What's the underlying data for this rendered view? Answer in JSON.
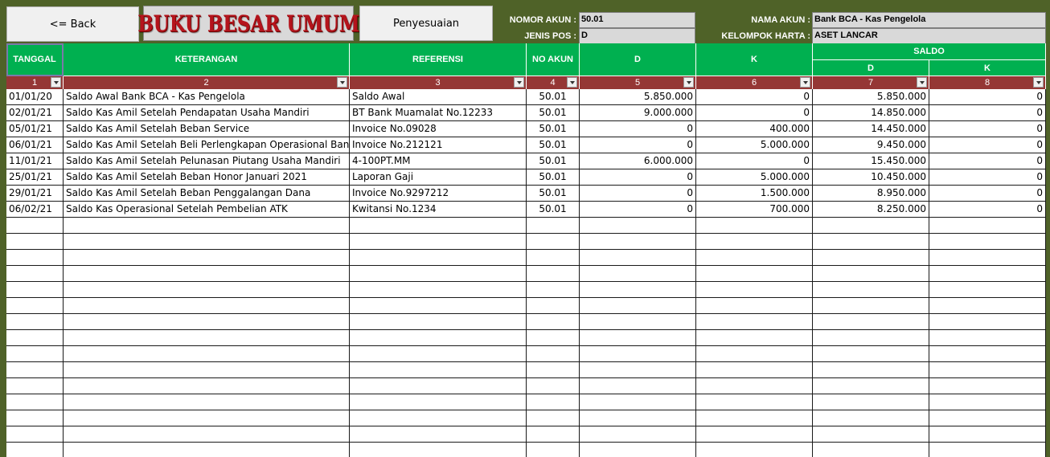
{
  "toolbar": {
    "back_label": "<= Back",
    "title": "BUKU BESAR UMUM",
    "adjust_label": "Penyesuaian"
  },
  "account": {
    "nomor_label": "NOMOR AKUN :",
    "nomor_value": "50.01",
    "jenis_label": "JENIS POS :",
    "jenis_value": "D",
    "nama_label": "NAMA AKUN :",
    "nama_value": "Bank BCA - Kas Pengelola",
    "kelompok_label": "KELOMPOK HARTA :",
    "kelompok_value": "ASET LANCAR"
  },
  "table": {
    "headers": {
      "tanggal": "TANGGAL",
      "keterangan": "KETERANGAN",
      "referensi": "REFERENSI",
      "no_akun": "NO AKUN",
      "debit": "D",
      "kredit": "K",
      "saldo": "SALDO",
      "saldo_debit": "D",
      "saldo_kredit": "K"
    },
    "col_numbers": [
      "1",
      "2",
      "3",
      "4",
      "5",
      "6",
      "7",
      "8"
    ],
    "rows": [
      [
        "01/01/20",
        "Saldo Awal Bank BCA - Kas Pengelola",
        "Saldo Awal",
        "50.01",
        "5.850.000",
        "0",
        "5.850.000",
        "0"
      ],
      [
        "02/01/21",
        "Saldo Kas Amil Setelah Pendapatan Usaha Mandiri",
        "BT Bank Muamalat No.12233",
        "50.01",
        "9.000.000",
        "0",
        "14.850.000",
        "0"
      ],
      [
        "05/01/21",
        "Saldo Kas Amil Setelah Beban Service",
        "Invoice No.09028",
        "50.01",
        "0",
        "400.000",
        "14.450.000",
        "0"
      ],
      [
        "06/01/21",
        "Saldo Kas Amil Setelah Beli Perlengkapan Operasional Banjir",
        "Invoice No.212121",
        "50.01",
        "0",
        "5.000.000",
        "9.450.000",
        "0"
      ],
      [
        "11/01/21",
        "Saldo Kas Amil Setelah Pelunasan Piutang Usaha Mandiri",
        "4-100PT.MM",
        "50.01",
        "6.000.000",
        "0",
        "15.450.000",
        "0"
      ],
      [
        "25/01/21",
        "Saldo Kas Amil Setelah Beban Honor Januari 2021",
        "Laporan Gaji",
        "50.01",
        "0",
        "5.000.000",
        "10.450.000",
        "0"
      ],
      [
        "29/01/21",
        "Saldo Kas Amil Setelah Beban Penggalangan Dana",
        "Invoice No.9297212",
        "50.01",
        "0",
        "1.500.000",
        "8.950.000",
        "0"
      ],
      [
        "06/02/21",
        "Saldo Kas Operasional Setelah Pembelian ATK",
        "Kwitansi No.1234",
        "50.01",
        "0",
        "700.000",
        "8.250.000",
        "0"
      ]
    ],
    "empty_rows": 15
  }
}
